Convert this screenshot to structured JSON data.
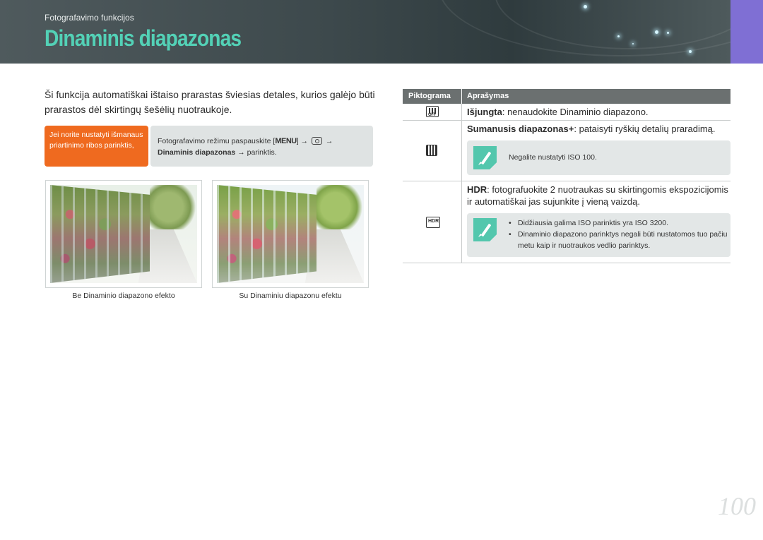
{
  "header": {
    "breadcrumb": "Fotografavimo funkcijos",
    "title": "Dinaminis diapazonas"
  },
  "intro": "Ši funkcija automatiškai ištaiso prarastas šviesias detales, kurios galėjo būti prarastos dėl skirtingų šešėlių nuotraukoje.",
  "tip": {
    "label": "Jei norite nustatyti išmanaus priartinimo ribos parinktis,",
    "text_prefix": "Fotografavimo režimu paspauskite [",
    "menu_key": "MENU",
    "text_after_menu": "] → ",
    "text_arrow": " →",
    "option_bold": "Dinaminis diapazonas",
    "text_suffix": " → parinktis.",
    "camera_icon": "camera-icon"
  },
  "photos": [
    {
      "caption": "Be Dinaminio diapazono efekto"
    },
    {
      "caption": "Su Dinaminiu diapazonu efektu"
    }
  ],
  "table": {
    "header_icon": "Piktograma",
    "header_desc": "Aprašymas",
    "rows": [
      {
        "icon": "dr-off-icon",
        "name": "Išjungta",
        "desc": ": nenaudokite Dinaminio diapazono."
      },
      {
        "icon": "smart-range-plus-icon",
        "name": "Sumanusis diapazonas+",
        "desc": ": pataisyti ryškių detalių praradimą.",
        "note": "Negalite nustatyti ISO 100."
      },
      {
        "icon": "hdr-icon",
        "name": "HDR",
        "desc": ": fotografuokite 2 nuotraukas su skirtingomis ekspozicijomis ir automatiškai jas sujunkite į vieną vaizdą.",
        "notes": [
          "Didžiausia galima ISO parinktis yra ISO 3200.",
          "Dinaminio diapazono parinktys negali būti nustatomos tuo pačiu metu kaip ir nuotraukos vedlio parinktys."
        ]
      }
    ]
  },
  "page_number": "100",
  "colors": {
    "title": "#53d1b6",
    "tip_label_bg": "#ef6a1f",
    "side_tab": "#7f6fd4",
    "table_header": "#6b7070",
    "note_icon": "#53c7ad"
  }
}
